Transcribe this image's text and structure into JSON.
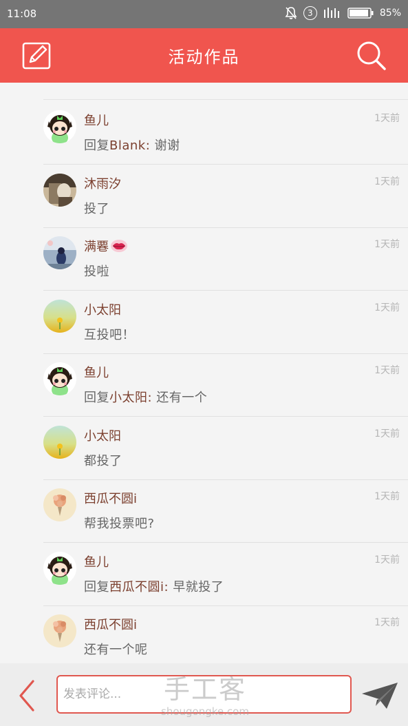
{
  "status_bar": {
    "time": "11:08",
    "notification_count": "3",
    "battery": "85%"
  },
  "app_bar": {
    "title": "活动作品"
  },
  "partial_row_text": "…………",
  "comments": [
    {
      "name": "鱼儿",
      "time": "1天前",
      "text_prefix": "回复",
      "reply_to": "Blank:",
      "text": " 谢谢",
      "avatar": "girl-avatar"
    },
    {
      "name": "沐雨汐",
      "time": "1天前",
      "text_prefix": "",
      "reply_to": "",
      "text": "投了",
      "avatar": "sepia-photo-avatar"
    },
    {
      "name": "满䙴",
      "time": "1天前",
      "text_prefix": "",
      "reply_to": "",
      "text": "投啦",
      "avatar": "night-photo-avatar",
      "emoji": "lips-emoji"
    },
    {
      "name": "小太阳",
      "time": "1天前",
      "text_prefix": "",
      "reply_to": "",
      "text": "互投吧！",
      "avatar": "sunflower-field-avatar"
    },
    {
      "name": "鱼儿",
      "time": "1天前",
      "text_prefix": "回复",
      "reply_to": "小太阳:",
      "text": " 还有一个",
      "avatar": "girl-avatar"
    },
    {
      "name": "小太阳",
      "time": "1天前",
      "text_prefix": "",
      "reply_to": "",
      "text": "都投了",
      "avatar": "sunflower-field-avatar"
    },
    {
      "name": "西瓜不圆i",
      "time": "1天前",
      "text_prefix": "",
      "reply_to": "",
      "text": "帮我投票吧?",
      "avatar": "flower-bouquet-avatar"
    },
    {
      "name": "鱼儿",
      "time": "1天前",
      "text_prefix": "回复",
      "reply_to": "西瓜不圆i:",
      "text": " 早就投了",
      "avatar": "girl-avatar"
    },
    {
      "name": "西瓜不圆i",
      "time": "1天前",
      "text_prefix": "",
      "reply_to": "",
      "text": "还有一个呢",
      "avatar": "flower-bouquet-avatar"
    }
  ],
  "bottom_bar": {
    "input_placeholder": "发表评论..."
  },
  "watermark": {
    "brand": "手工客",
    "url": "shougongke.com"
  },
  "colors": {
    "accent": "#f0554e",
    "name_color": "#7b3f2e",
    "time_color": "#b5b5b5"
  }
}
